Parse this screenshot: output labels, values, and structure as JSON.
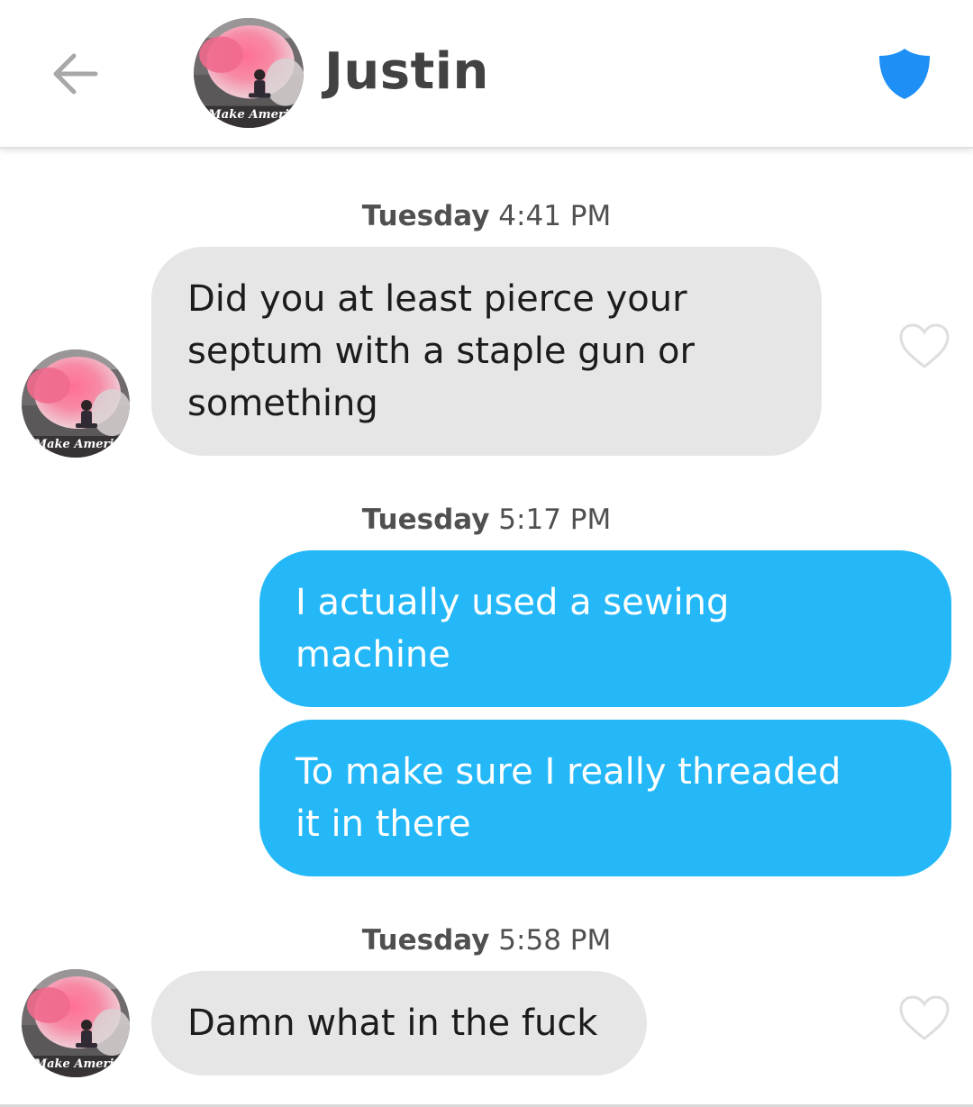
{
  "header": {
    "name": "Justin",
    "back_icon": "arrow-left-icon",
    "safety_icon": "shield-icon",
    "avatar_caption": "Make Ameri"
  },
  "colors": {
    "outgoing_bubble": "#24b8f8",
    "incoming_bubble": "#e6e6e6",
    "shield": "#1e8ff5"
  },
  "messages": [
    {
      "timestamp_day": "Tuesday",
      "timestamp_time": "4:41 PM",
      "direction": "incoming",
      "lines": [
        "Did you at least pierce your",
        "septum with a staple gun or",
        "something"
      ]
    },
    {
      "timestamp_day": "Tuesday",
      "timestamp_time": "5:17 PM",
      "direction": "outgoing",
      "lines": [
        "I actually used a sewing",
        "machine"
      ]
    },
    {
      "direction": "outgoing",
      "lines": [
        "To make sure I really threaded",
        "it in there"
      ]
    },
    {
      "timestamp_day": "Tuesday",
      "timestamp_time": "5:58 PM",
      "direction": "incoming",
      "lines": [
        "Damn what in the fuck"
      ]
    }
  ]
}
